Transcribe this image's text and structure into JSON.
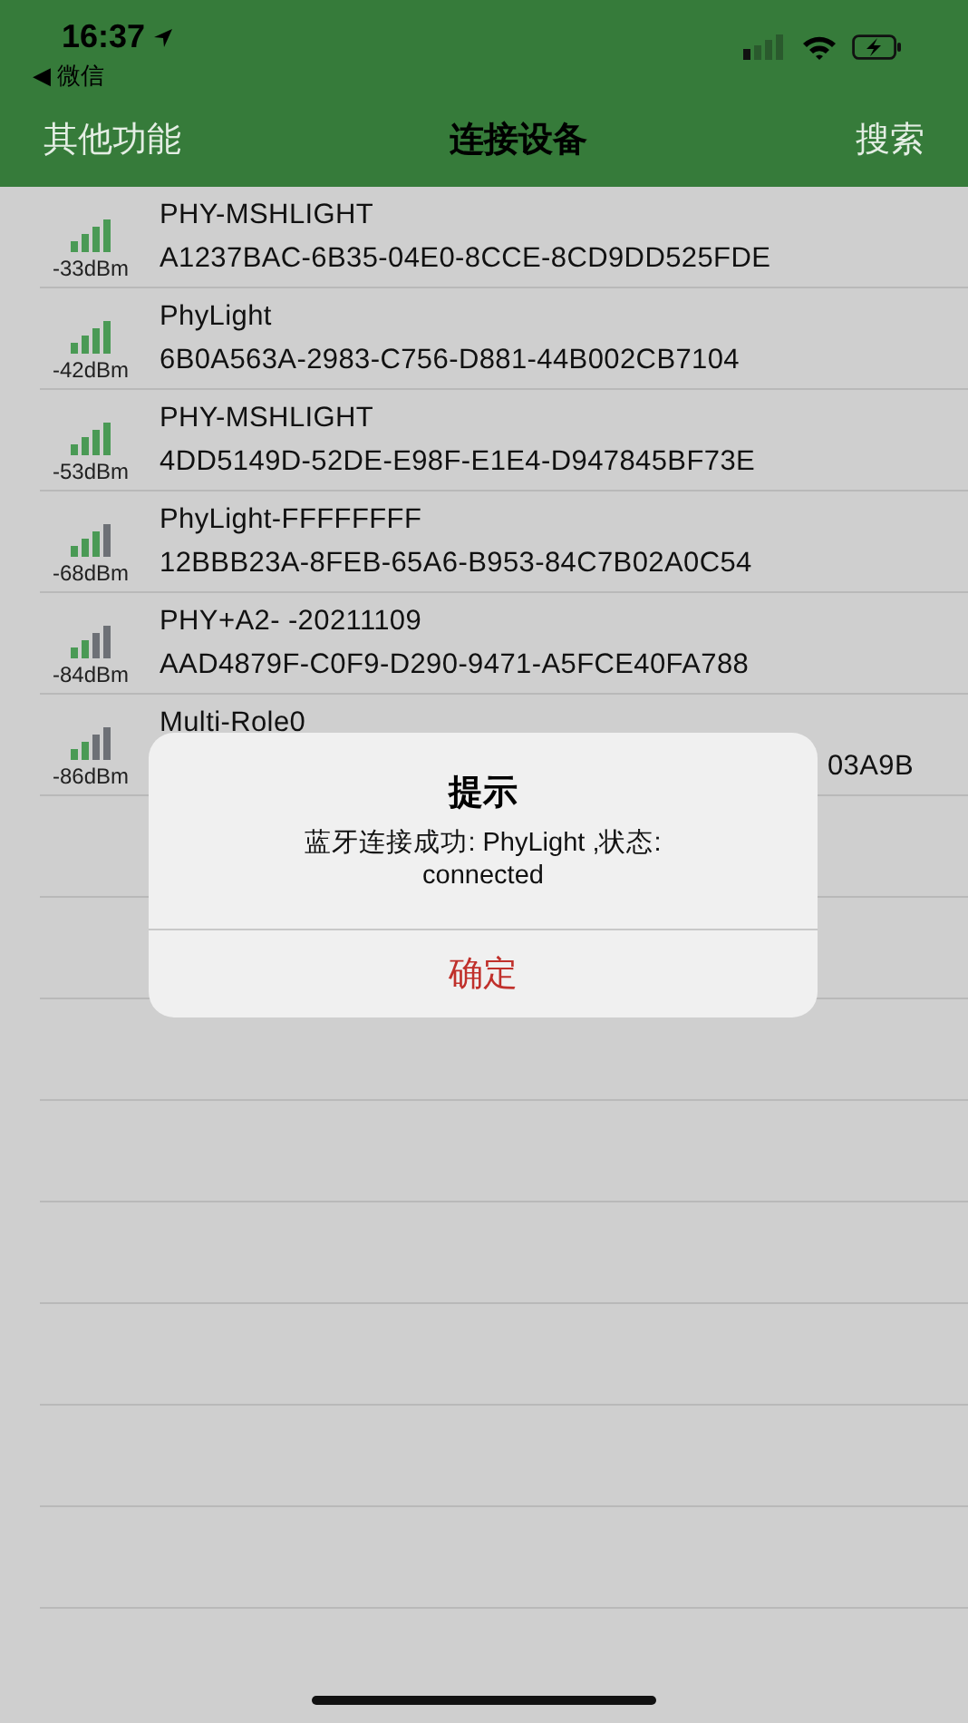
{
  "status_bar": {
    "time": "16:37",
    "back_label": "◀ 微信"
  },
  "nav": {
    "left": "其他功能",
    "title": "连接设备",
    "right": "搜索"
  },
  "devices": [
    {
      "name": "PHY-MSHLIGHT",
      "uuid": "A1237BAC-6B35-04E0-8CCE-8CD9DD525FDE",
      "rssi": "-33dBm",
      "bars": [
        {
          "on": true
        },
        {
          "on": true
        },
        {
          "on": true
        },
        {
          "on": true
        }
      ]
    },
    {
      "name": "PhyLight",
      "uuid": "6B0A563A-2983-C756-D881-44B002CB7104",
      "rssi": "-42dBm",
      "bars": [
        {
          "on": true
        },
        {
          "on": true
        },
        {
          "on": true
        },
        {
          "on": true
        }
      ]
    },
    {
      "name": "PHY-MSHLIGHT",
      "uuid": "4DD5149D-52DE-E98F-E1E4-D947845BF73E",
      "rssi": "-53dBm",
      "bars": [
        {
          "on": true
        },
        {
          "on": true
        },
        {
          "on": true
        },
        {
          "on": true
        }
      ]
    },
    {
      "name": "PhyLight-FFFFFFFF",
      "uuid": "12BBB23A-8FEB-65A6-B953-84C7B02A0C54",
      "rssi": "-68dBm",
      "bars": [
        {
          "on": true
        },
        {
          "on": true
        },
        {
          "on": true
        },
        {
          "on": false
        }
      ]
    },
    {
      "name": "PHY+A2- -20211109",
      "uuid": "AAD4879F-C0F9-D290-9471-A5FCE40FA788",
      "rssi": "-84dBm",
      "bars": [
        {
          "on": true
        },
        {
          "on": true
        },
        {
          "on": false
        },
        {
          "on": false
        }
      ]
    },
    {
      "name": "Multi-Role0",
      "uuid": "03A9B",
      "rssi": "-86dBm",
      "bars": [
        {
          "on": true
        },
        {
          "on": true
        },
        {
          "on": false
        },
        {
          "on": false
        }
      ],
      "uuid_partial": true
    }
  ],
  "dialog": {
    "title": "提示",
    "message": "蓝牙连接成功: PhyLight ,状态: connected",
    "button": "确定"
  }
}
